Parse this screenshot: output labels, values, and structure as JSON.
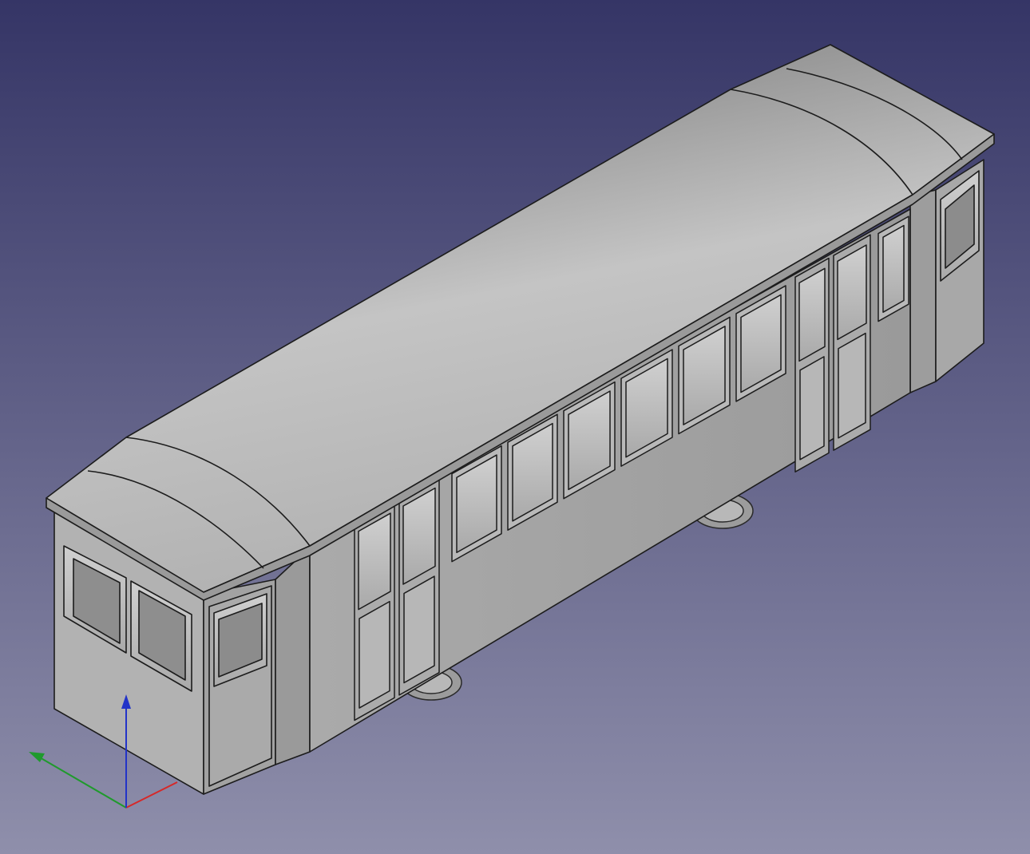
{
  "viewport": {
    "background_top": "#353566",
    "background_bottom": "#8f8fab"
  },
  "model": {
    "body_side_color": "#a4a4a4",
    "body_end_color": "#b4b4b4",
    "roof_light": "#d7d7d7",
    "roof_dark": "#6b6b6b",
    "window_fill": "#c9c9c9",
    "interior_fill": "#888888",
    "edge_color": "#1c1c1c"
  },
  "axis_triad": {
    "x_color": "#d62828",
    "y_color": "#1f9a2c",
    "z_color": "#2233c8",
    "icons": [
      "x-axis-icon",
      "y-axis-icon",
      "z-axis-icon"
    ]
  }
}
